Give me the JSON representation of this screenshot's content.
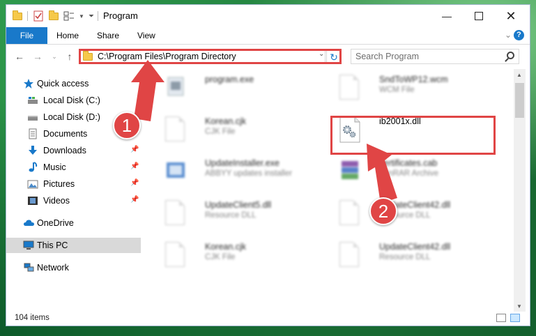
{
  "window": {
    "title": "Program",
    "controls": [
      "minimize",
      "maximize",
      "close"
    ]
  },
  "ribbon": {
    "tabs": [
      {
        "label": "File",
        "active": true
      },
      {
        "label": "Home"
      },
      {
        "label": "Share"
      },
      {
        "label": "View"
      }
    ],
    "help": "?"
  },
  "address": {
    "path": "C:\\Program Files\\Program Directory",
    "search_placeholder": "Search Program"
  },
  "navigation": {
    "items": [
      {
        "label": "Quick access",
        "icon": "star-icon",
        "level": "top"
      },
      {
        "label": "Local Disk (C:)",
        "icon": "drive-icon",
        "pinned": true
      },
      {
        "label": "Local Disk (D:)",
        "icon": "drive-icon",
        "pinned": true
      },
      {
        "label": "Documents",
        "icon": "documents-icon",
        "pinned": true
      },
      {
        "label": "Downloads",
        "icon": "download-arrow-icon",
        "pinned": true
      },
      {
        "label": "Music",
        "icon": "music-note-icon",
        "pinned": true
      },
      {
        "label": "Pictures",
        "icon": "pictures-icon",
        "pinned": true
      },
      {
        "label": "Videos",
        "icon": "film-icon",
        "pinned": true
      },
      {
        "label": "OneDrive",
        "icon": "cloud-icon",
        "level": "top"
      },
      {
        "label": "This PC",
        "icon": "monitor-icon",
        "level": "top",
        "selected": true
      },
      {
        "label": "Network",
        "icon": "network-icon",
        "level": "top"
      }
    ]
  },
  "files": [
    {
      "name": "program.exe",
      "type": "",
      "blurred": true
    },
    {
      "name": "SndToWP12.wcm",
      "type": "WCM File",
      "blurred": true
    },
    {
      "name": "Korean.cjk",
      "type": "CJK File",
      "blurred": true
    },
    {
      "name": "ib2001x.dll",
      "type": "",
      "blurred": false,
      "highlighted": true
    },
    {
      "name": "UpdateInstaller.exe",
      "type": "ABBYY updates installer",
      "blurred": true
    },
    {
      "name": "certificates.cab",
      "type": "WinRAR Archive",
      "blurred": true
    },
    {
      "name": "UpdateClient5.dll",
      "type": "Resource DLL",
      "blurred": true
    },
    {
      "name": "UpdateClient42.dll",
      "type": "Resource DLL",
      "blurred": true
    },
    {
      "name": "Korean.cjk",
      "type": "CJK File",
      "blurred": true
    },
    {
      "name": "UpdateClient42.dll",
      "type": "Resource DLL",
      "blurred": true
    }
  ],
  "status": {
    "item_count": "104 items"
  },
  "annotations": {
    "step1": "1",
    "step2": "2",
    "color": "#e04545"
  }
}
